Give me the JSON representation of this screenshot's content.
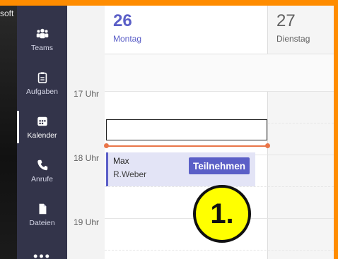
{
  "desktop": {
    "partial_text": "soft"
  },
  "rail": {
    "items": [
      {
        "label": "Teams",
        "icon": "teams-icon"
      },
      {
        "label": "Aufgaben",
        "icon": "tasks-icon"
      },
      {
        "label": "Kalender",
        "icon": "calendar-icon",
        "active": true
      },
      {
        "label": "Anrufe",
        "icon": "phone-icon"
      },
      {
        "label": "Dateien",
        "icon": "files-icon"
      }
    ],
    "more": "•••"
  },
  "calendar": {
    "days": [
      {
        "number": "26",
        "name": "Montag"
      },
      {
        "number": "27",
        "name": "Dienstag"
      }
    ],
    "hours": [
      "17 Uhr",
      "18 Uhr",
      "19 Uhr"
    ],
    "event": {
      "title": "Max",
      "organizer": "R.Weber",
      "join_label": "Teilnehmen"
    }
  },
  "annotation": {
    "step": "1."
  },
  "colors": {
    "frame": "#ff8c00",
    "rail": "#33344a",
    "accent": "#5b5fc7",
    "now_line": "#e97548",
    "event_bg": "#e3e4f6",
    "badge": "#ffff00"
  }
}
